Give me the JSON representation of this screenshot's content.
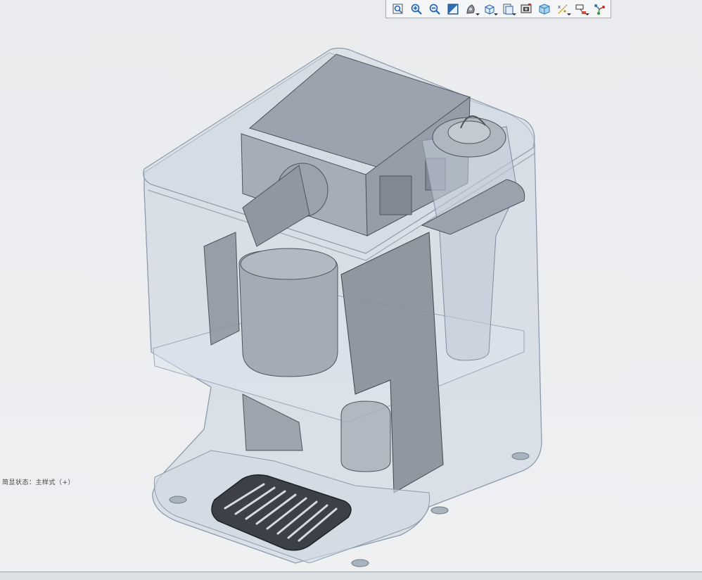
{
  "viewport": {
    "status_text": "简显状态：主样式（+）"
  },
  "toolbar": {
    "buttons": [
      {
        "name": "zoom-fit",
        "icon": "zoom-fit-icon"
      },
      {
        "name": "zoom-in",
        "icon": "zoom-in-icon"
      },
      {
        "name": "zoom-out",
        "icon": "zoom-out-icon"
      },
      {
        "name": "repaint",
        "icon": "repaint-icon"
      },
      {
        "name": "display-style",
        "icon": "shading-icon"
      },
      {
        "name": "saved-orientations",
        "icon": "view-cube-icon"
      },
      {
        "name": "view-manager",
        "icon": "view-manager-icon"
      },
      {
        "name": "appearance",
        "icon": "appearance-icon"
      },
      {
        "name": "perspective",
        "icon": "perspective-icon"
      },
      {
        "name": "datum-display",
        "icon": "datum-icon"
      },
      {
        "name": "annotation-display",
        "icon": "annotation-icon"
      },
      {
        "name": "spin-center",
        "icon": "spin-center-icon"
      }
    ]
  },
  "colors": {
    "background": "#ebedf0",
    "toolbar": "#f5f6f7",
    "shell": "#c8d3e0",
    "parts": "#8e97a3",
    "tray": "#3a3d42"
  }
}
